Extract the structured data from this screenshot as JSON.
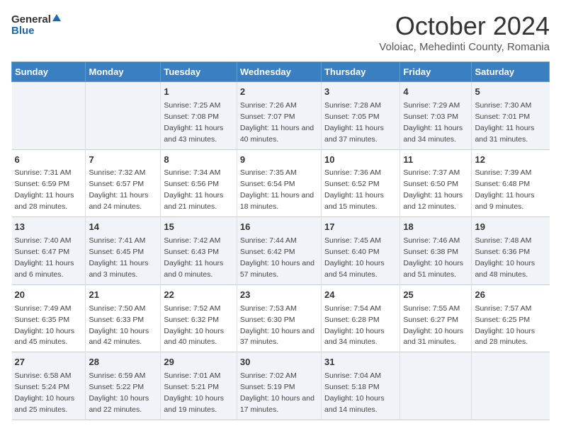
{
  "logo": {
    "line1": "General",
    "line2": "Blue"
  },
  "title": "October 2024",
  "location": "Voloiac, Mehedinti County, Romania",
  "headers": [
    "Sunday",
    "Monday",
    "Tuesday",
    "Wednesday",
    "Thursday",
    "Friday",
    "Saturday"
  ],
  "weeks": [
    [
      {
        "day": "",
        "info": ""
      },
      {
        "day": "",
        "info": ""
      },
      {
        "day": "1",
        "info": "Sunrise: 7:25 AM\nSunset: 7:08 PM\nDaylight: 11 hours and 43 minutes."
      },
      {
        "day": "2",
        "info": "Sunrise: 7:26 AM\nSunset: 7:07 PM\nDaylight: 11 hours and 40 minutes."
      },
      {
        "day": "3",
        "info": "Sunrise: 7:28 AM\nSunset: 7:05 PM\nDaylight: 11 hours and 37 minutes."
      },
      {
        "day": "4",
        "info": "Sunrise: 7:29 AM\nSunset: 7:03 PM\nDaylight: 11 hours and 34 minutes."
      },
      {
        "day": "5",
        "info": "Sunrise: 7:30 AM\nSunset: 7:01 PM\nDaylight: 11 hours and 31 minutes."
      }
    ],
    [
      {
        "day": "6",
        "info": "Sunrise: 7:31 AM\nSunset: 6:59 PM\nDaylight: 11 hours and 28 minutes."
      },
      {
        "day": "7",
        "info": "Sunrise: 7:32 AM\nSunset: 6:57 PM\nDaylight: 11 hours and 24 minutes."
      },
      {
        "day": "8",
        "info": "Sunrise: 7:34 AM\nSunset: 6:56 PM\nDaylight: 11 hours and 21 minutes."
      },
      {
        "day": "9",
        "info": "Sunrise: 7:35 AM\nSunset: 6:54 PM\nDaylight: 11 hours and 18 minutes."
      },
      {
        "day": "10",
        "info": "Sunrise: 7:36 AM\nSunset: 6:52 PM\nDaylight: 11 hours and 15 minutes."
      },
      {
        "day": "11",
        "info": "Sunrise: 7:37 AM\nSunset: 6:50 PM\nDaylight: 11 hours and 12 minutes."
      },
      {
        "day": "12",
        "info": "Sunrise: 7:39 AM\nSunset: 6:48 PM\nDaylight: 11 hours and 9 minutes."
      }
    ],
    [
      {
        "day": "13",
        "info": "Sunrise: 7:40 AM\nSunset: 6:47 PM\nDaylight: 11 hours and 6 minutes."
      },
      {
        "day": "14",
        "info": "Sunrise: 7:41 AM\nSunset: 6:45 PM\nDaylight: 11 hours and 3 minutes."
      },
      {
        "day": "15",
        "info": "Sunrise: 7:42 AM\nSunset: 6:43 PM\nDaylight: 11 hours and 0 minutes."
      },
      {
        "day": "16",
        "info": "Sunrise: 7:44 AM\nSunset: 6:42 PM\nDaylight: 10 hours and 57 minutes."
      },
      {
        "day": "17",
        "info": "Sunrise: 7:45 AM\nSunset: 6:40 PM\nDaylight: 10 hours and 54 minutes."
      },
      {
        "day": "18",
        "info": "Sunrise: 7:46 AM\nSunset: 6:38 PM\nDaylight: 10 hours and 51 minutes."
      },
      {
        "day": "19",
        "info": "Sunrise: 7:48 AM\nSunset: 6:36 PM\nDaylight: 10 hours and 48 minutes."
      }
    ],
    [
      {
        "day": "20",
        "info": "Sunrise: 7:49 AM\nSunset: 6:35 PM\nDaylight: 10 hours and 45 minutes."
      },
      {
        "day": "21",
        "info": "Sunrise: 7:50 AM\nSunset: 6:33 PM\nDaylight: 10 hours and 42 minutes."
      },
      {
        "day": "22",
        "info": "Sunrise: 7:52 AM\nSunset: 6:32 PM\nDaylight: 10 hours and 40 minutes."
      },
      {
        "day": "23",
        "info": "Sunrise: 7:53 AM\nSunset: 6:30 PM\nDaylight: 10 hours and 37 minutes."
      },
      {
        "day": "24",
        "info": "Sunrise: 7:54 AM\nSunset: 6:28 PM\nDaylight: 10 hours and 34 minutes."
      },
      {
        "day": "25",
        "info": "Sunrise: 7:55 AM\nSunset: 6:27 PM\nDaylight: 10 hours and 31 minutes."
      },
      {
        "day": "26",
        "info": "Sunrise: 7:57 AM\nSunset: 6:25 PM\nDaylight: 10 hours and 28 minutes."
      }
    ],
    [
      {
        "day": "27",
        "info": "Sunrise: 6:58 AM\nSunset: 5:24 PM\nDaylight: 10 hours and 25 minutes."
      },
      {
        "day": "28",
        "info": "Sunrise: 6:59 AM\nSunset: 5:22 PM\nDaylight: 10 hours and 22 minutes."
      },
      {
        "day": "29",
        "info": "Sunrise: 7:01 AM\nSunset: 5:21 PM\nDaylight: 10 hours and 19 minutes."
      },
      {
        "day": "30",
        "info": "Sunrise: 7:02 AM\nSunset: 5:19 PM\nDaylight: 10 hours and 17 minutes."
      },
      {
        "day": "31",
        "info": "Sunrise: 7:04 AM\nSunset: 5:18 PM\nDaylight: 10 hours and 14 minutes."
      },
      {
        "day": "",
        "info": ""
      },
      {
        "day": "",
        "info": ""
      }
    ]
  ]
}
